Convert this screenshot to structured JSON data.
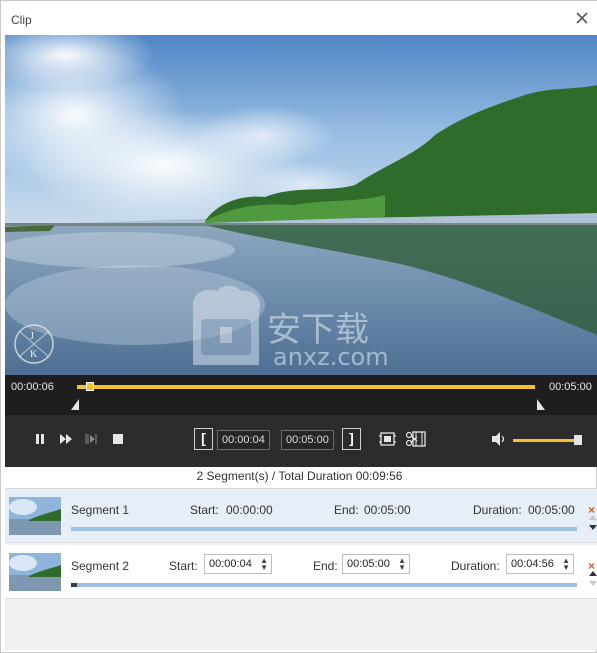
{
  "window": {
    "title": "Clip"
  },
  "video": {
    "watermark_letters": [
      "J",
      "K"
    ],
    "site_watermark": [
      "安下载",
      "anxz.com"
    ]
  },
  "timeline": {
    "current_time": "00:00:06",
    "end_time": "00:05:00",
    "progress": 0.02
  },
  "controls": {
    "pause_icon": "pause-icon",
    "fast_forward_icon": "fast-forward-icon",
    "next_frame_icon": "next-frame-icon",
    "stop_icon": "stop-icon",
    "start_bracket": "[",
    "end_bracket": "]",
    "start_time": "00:00:04",
    "end_time": "00:05:00",
    "volume_level": 0.95
  },
  "summary": "2 Segment(s) / Total Duration 00:09:56",
  "segments": [
    {
      "name": "Segment 1",
      "start_label": "Start:",
      "start": "00:00:00",
      "end_label": "End:",
      "end": "00:05:00",
      "duration_label": "Duration:",
      "duration": "00:05:00",
      "delete": "×"
    },
    {
      "name": "Segment 2",
      "start_label": "Start:",
      "start": "00:00:04",
      "end_label": "End:",
      "end": "00:05:00",
      "duration_label": "Duration:",
      "duration": "00:04:56",
      "delete": "×"
    }
  ],
  "colors": {
    "accent": "#f5c02c",
    "panel_dark": "#2c2c2c",
    "segment_bar": "#9dbfe0",
    "delete": "#e05a1e",
    "selected_row": "#e6eef8"
  }
}
